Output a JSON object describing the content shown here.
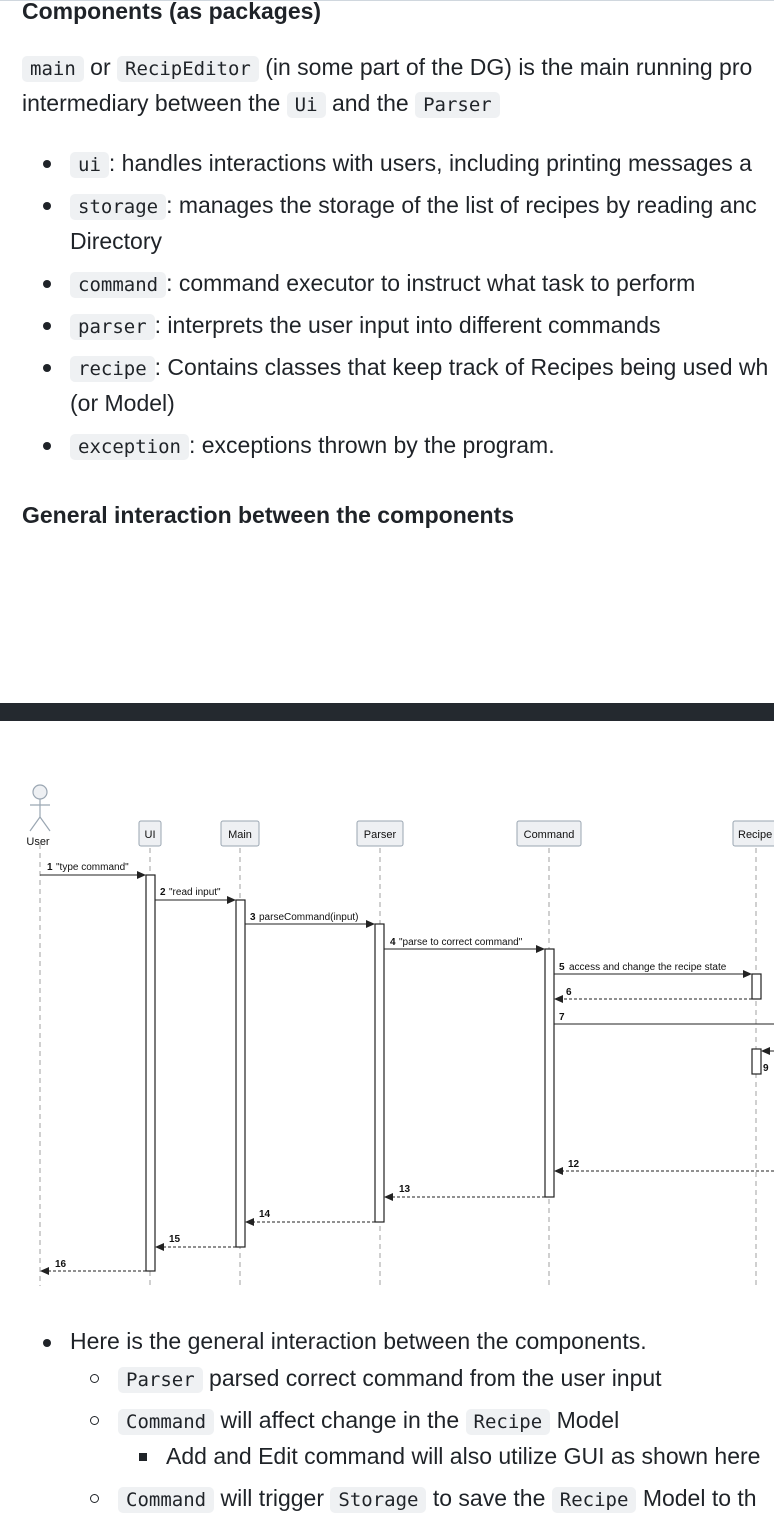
{
  "section_title": "Components (as packages)",
  "intro": {
    "code1": "main",
    "text1": "or",
    "code2": "RecipEditor",
    "text2": "(in some part of the DG) is the main running pro",
    "line2_text": "intermediary between the",
    "code3": "Ui",
    "text3": "and the",
    "code4": "Parser"
  },
  "packages": [
    {
      "code": "ui",
      "desc": ": handles interactions with users, including printing messages a"
    },
    {
      "code": "storage",
      "desc": ": manages the storage of the list of recipes by reading anc",
      "cont": "Directory"
    },
    {
      "code": "command",
      "desc": ": command executor to instruct what task to perform"
    },
    {
      "code": "parser",
      "desc": ": interprets the user input into different commands"
    },
    {
      "code": "recipe",
      "desc": ": Contains classes that keep track of Recipes being used wh",
      "cont": "(or Model)"
    },
    {
      "code": "exception",
      "desc": ": exceptions thrown by the program."
    }
  ],
  "interaction_title": "General interaction between the components",
  "diagram": {
    "actor": "User",
    "participants": [
      "UI",
      "Main",
      "Parser",
      "Command",
      "Recipe"
    ],
    "messages": [
      {
        "n": "1",
        "label": "\"type command\""
      },
      {
        "n": "2",
        "label": "\"read input\""
      },
      {
        "n": "3",
        "label": "parseCommand(input)"
      },
      {
        "n": "4",
        "label": "\"parse to correct command\""
      },
      {
        "n": "5",
        "label": "access and change the recipe state"
      },
      {
        "n": "6",
        "label": ""
      },
      {
        "n": "7",
        "label": ""
      },
      {
        "n": "9",
        "label": ""
      },
      {
        "n": "12",
        "label": ""
      },
      {
        "n": "13",
        "label": ""
      },
      {
        "n": "14",
        "label": ""
      },
      {
        "n": "15",
        "label": ""
      },
      {
        "n": "16",
        "label": ""
      }
    ]
  },
  "notes": {
    "main": "Here is the general interaction between the components.",
    "sub1_code": "Parser",
    "sub1_text": "parsed correct command from the user input",
    "sub2_code": "Command",
    "sub2_text1": "will affect change in the",
    "sub2_code2": "Recipe",
    "sub2_text2": "Model",
    "subsub1": "Add and Edit command will also utilize GUI as shown here",
    "sub3_code": "Command",
    "sub3_text1": "will trigger",
    "sub3_code2": "Storage",
    "sub3_text2": "to save the",
    "sub3_code3": "Recipe",
    "sub3_text3": "Model to th"
  }
}
